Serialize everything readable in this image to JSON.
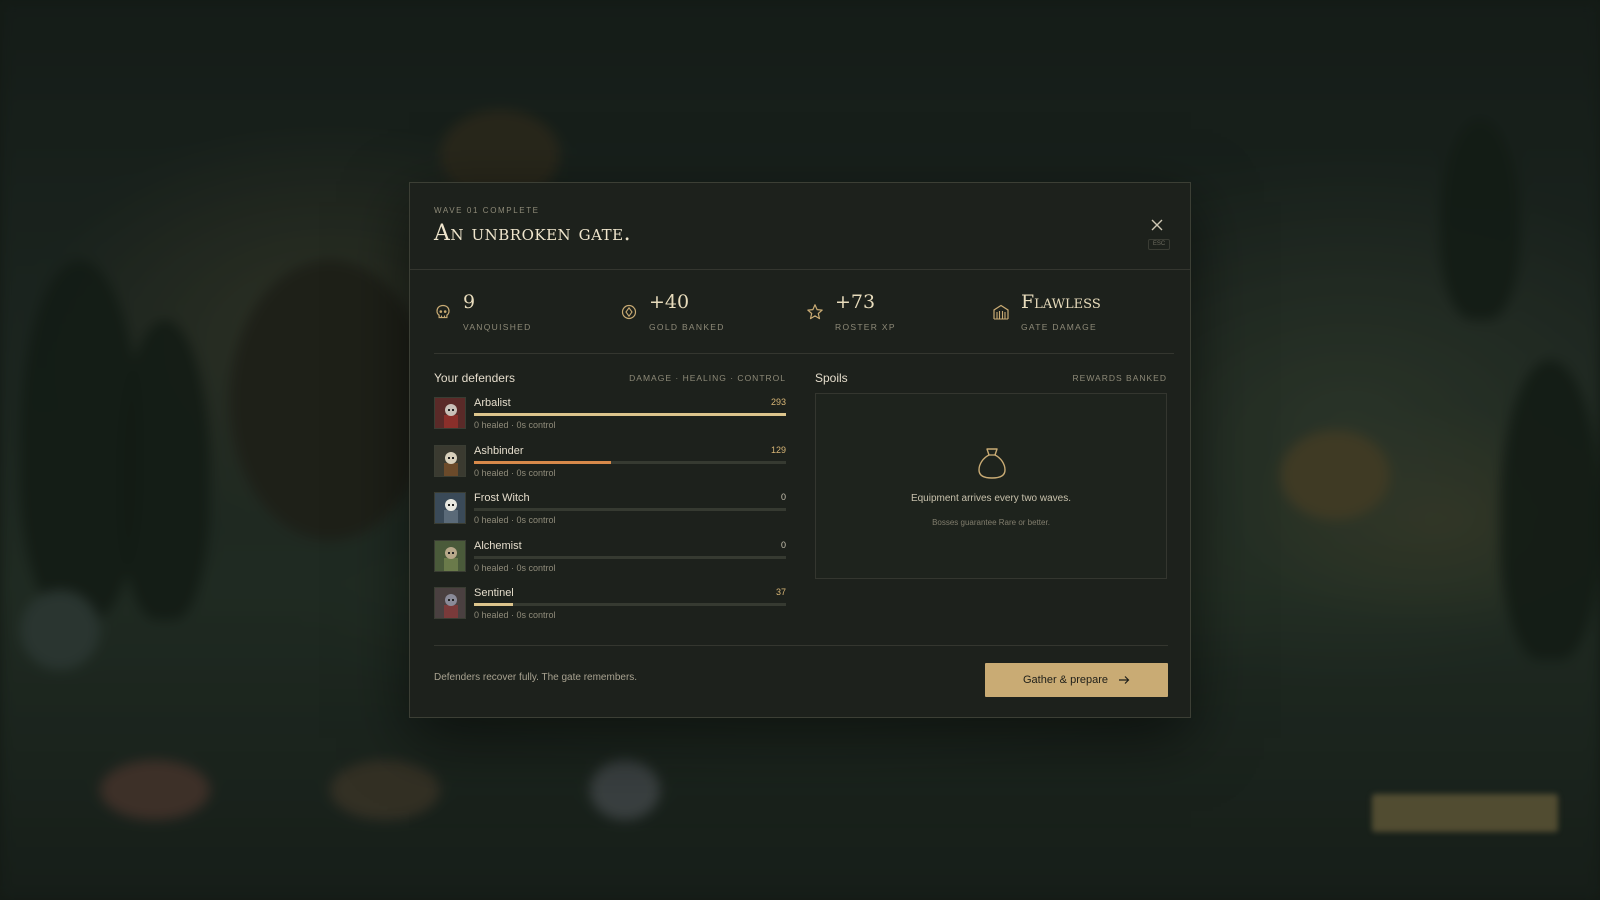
{
  "wave": {
    "eyebrow": "WAVE 01 COMPLETE",
    "title": "An unbroken gate.",
    "esc_hint": "ESC"
  },
  "stats": [
    {
      "icon": "skull-icon",
      "value": "9",
      "label": "VANQUISHED"
    },
    {
      "icon": "coin-icon",
      "value": "+40",
      "label": "GOLD BANKED"
    },
    {
      "icon": "star-icon",
      "value": "+73",
      "label": "ROSTER XP"
    },
    {
      "icon": "gate-icon",
      "value": "Flawless",
      "label": "GATE DAMAGE"
    }
  ],
  "defenders": {
    "title": "Your defenders",
    "meta": "DAMAGE · HEALING · CONTROL",
    "max_value": 293,
    "list": [
      {
        "name": "Arbalist",
        "value": 293,
        "value_label": "293",
        "sub": "0 healed · 0s control",
        "bar_color": "#dcc48c",
        "portrait": "arbalist"
      },
      {
        "name": "Ashbinder",
        "value": 129,
        "value_label": "129",
        "sub": "0 healed · 0s control",
        "bar_color": "#d7894a",
        "portrait": "ashbinder"
      },
      {
        "name": "Frost Witch",
        "value": 0,
        "value_label": "0",
        "sub": "0 healed · 0s control",
        "bar_color": "#9fb6c4",
        "portrait": "frost-witch"
      },
      {
        "name": "Alchemist",
        "value": 0,
        "value_label": "0",
        "sub": "0 healed · 0s control",
        "bar_color": "#9cae78",
        "portrait": "alchemist"
      },
      {
        "name": "Sentinel",
        "value": 37,
        "value_label": "37",
        "sub": "0 healed · 0s control",
        "bar_color": "#dcc48c",
        "portrait": "sentinel"
      }
    ]
  },
  "spoils": {
    "title": "Spoils",
    "meta": "REWARDS BANKED",
    "message": "Equipment arrives every two waves.",
    "sub": "Bosses guarantee Rare or better."
  },
  "footer": {
    "note": "Defenders recover fully. The gate remembers.",
    "button_label": "Gather & prepare"
  },
  "colors": {
    "accent": "#c9ab74",
    "panel": "#1d211c",
    "text": "#e4dccb"
  }
}
